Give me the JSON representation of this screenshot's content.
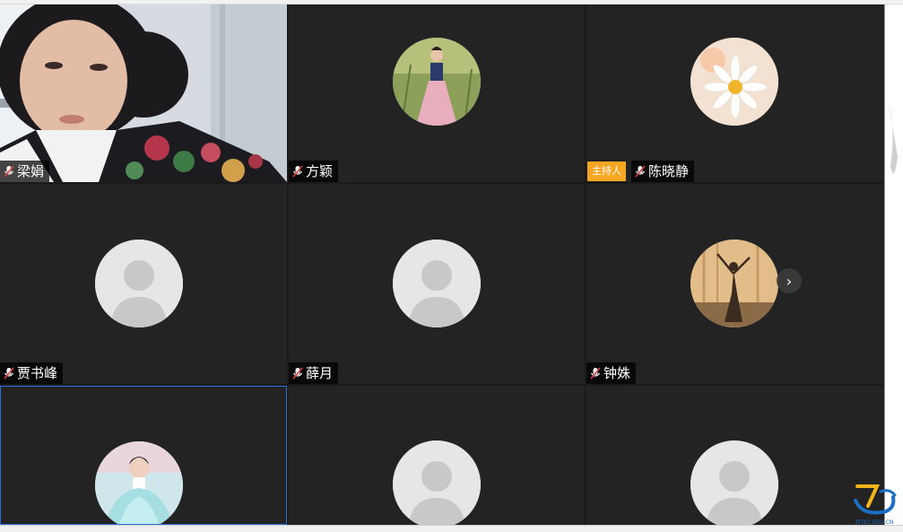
{
  "participants": [
    {
      "name": "梁娟",
      "avatar": "video-feed",
      "mic": "muted-icon"
    },
    {
      "name": "方颖",
      "avatar": "photo-woman-pink-dress",
      "mic": "muted-icon"
    },
    {
      "name": "陈晓静",
      "avatar": "photo-daisy",
      "mic": "muted-icon",
      "role": "主持人"
    },
    {
      "name": "贾书峰",
      "avatar": "default-silhouette",
      "mic": "muted-icon"
    },
    {
      "name": "薛月",
      "avatar": "default-silhouette",
      "mic": "muted-icon"
    },
    {
      "name": "钟姝",
      "avatar": "photo-dancer-silhouette",
      "mic": "muted-icon"
    },
    {
      "name": "",
      "avatar": "photo-woman-blue-dress"
    },
    {
      "name": "",
      "avatar": "default-silhouette"
    },
    {
      "name": "",
      "avatar": "default-silhouette"
    }
  ],
  "next_page": {
    "icon": "chevron-right-icon",
    "glyph": "›"
  },
  "watermark": {
    "text": "ZJTEC.EDU.CN"
  },
  "colors": {
    "tile_bg": "#232323",
    "host_badge": "#f5a623",
    "selected_border": "#2f6fd6"
  }
}
